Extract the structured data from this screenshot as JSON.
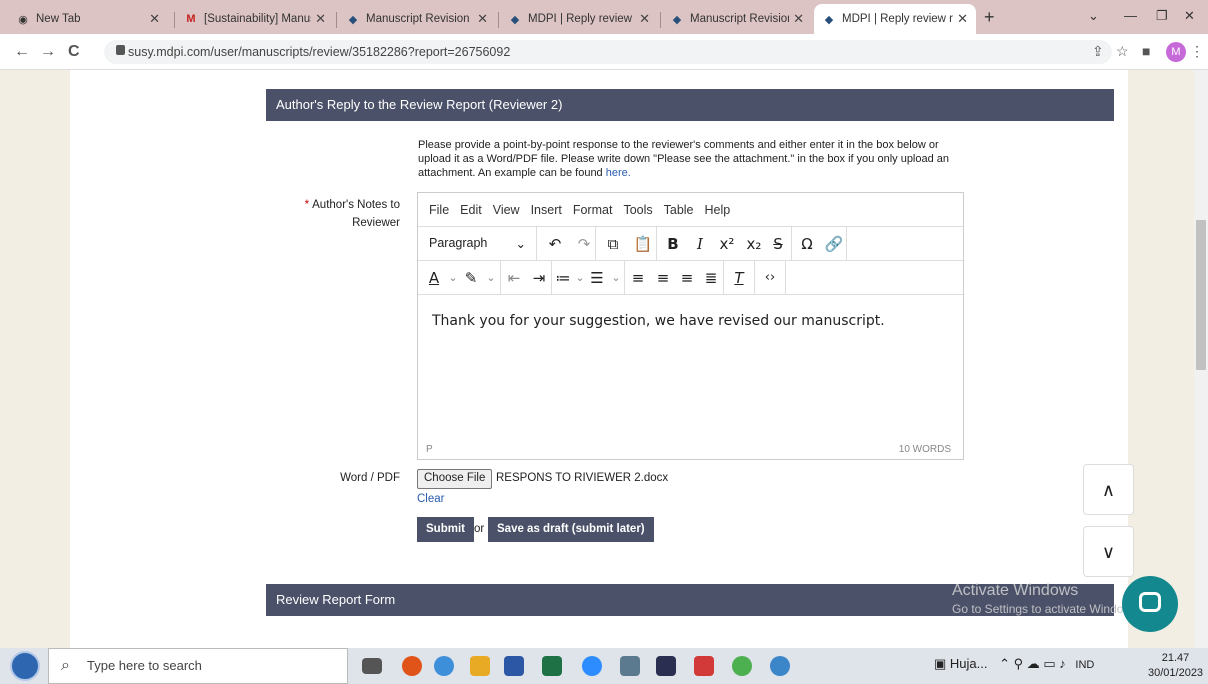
{
  "browser": {
    "tabs": [
      {
        "title": "New Tab",
        "icon": "chrome-icon"
      },
      {
        "title": "[Sustainability] Manus",
        "icon": "gmail-icon"
      },
      {
        "title": "Manuscript Revision",
        "icon": "mdpi-icon"
      },
      {
        "title": "MDPI | Reply review re",
        "icon": "mdpi-icon"
      },
      {
        "title": "Manuscript Revision",
        "icon": "mdpi-icon"
      },
      {
        "title": "MDPI | Reply review re",
        "icon": "mdpi-icon",
        "active": true
      }
    ],
    "url": "susy.mdpi.com/user/manuscripts/review/35182286?report=26756092",
    "profile_initial": "M"
  },
  "form": {
    "section_title": "Author's Reply to the Review Report (Reviewer 2)",
    "instructions": "Please provide a point-by-point response to the reviewer's comments and either enter it in the box below or upload it as a Word/PDF file. Please write down \"Please see the attachment.\" in the box if you only upload an attachment. An example can be found",
    "instructions_link": "here.",
    "notes_label_line1": "Author's Notes to",
    "notes_label_line2": "Reviewer",
    "required_mark": "*",
    "editor": {
      "menu": [
        "File",
        "Edit",
        "View",
        "Insert",
        "Format",
        "Tools",
        "Table",
        "Help"
      ],
      "block_format": "Paragraph",
      "content": "Thank you for your suggestion, we have revised our manuscript.",
      "path": "P",
      "word_count": "10 WORDS"
    },
    "file_label": "Word / PDF",
    "choose_file": "Choose File",
    "file_name": "RESPONS TO RIVIEWER 2.docx",
    "clear": "Clear",
    "submit": "Submit",
    "or": "or",
    "save_draft": "Save as draft (submit later)",
    "next_section_title": "Review Report Form"
  },
  "overlay": {
    "activate_title": "Activate Windows",
    "activate_sub": "Go to Settings to activate Windows."
  },
  "taskbar": {
    "search_placeholder": "Type here to search",
    "weather": "Huja...",
    "lang": "IND",
    "time": "21.47",
    "date": "30/01/2023"
  },
  "colors": {
    "header": "#4b5169",
    "link": "#2a5db0",
    "chat": "#13888e"
  }
}
